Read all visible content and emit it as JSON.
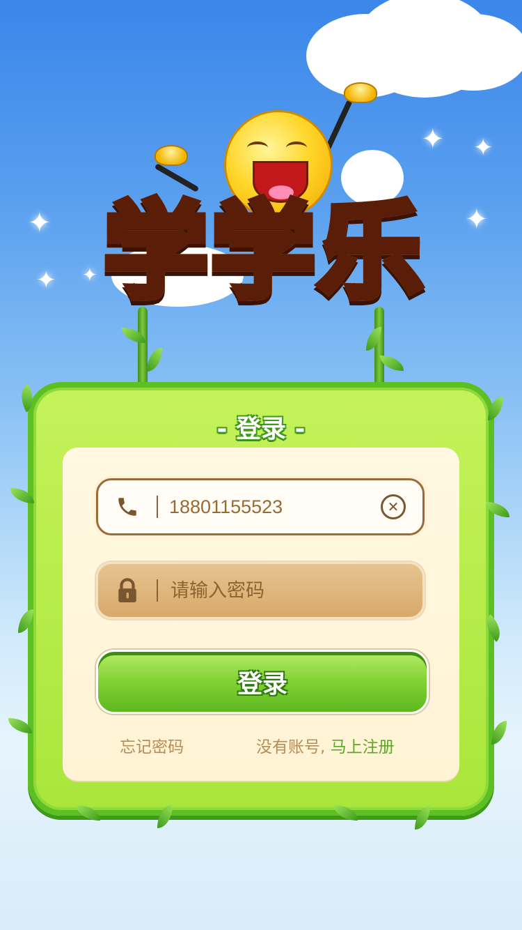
{
  "app": {
    "logo_text": "学学乐"
  },
  "login_card": {
    "title": "- 登录 -",
    "phone": {
      "value": "18801155523",
      "icon": "phone-icon",
      "clear_icon": "clear-icon"
    },
    "password": {
      "placeholder": "请输入密码",
      "icon": "lock-icon"
    },
    "login_button": "登录",
    "forgot_password": "忘记密码",
    "no_account": "没有账号,",
    "register_now": "马上注册"
  },
  "colors": {
    "accent_green": "#5cbf22",
    "text_brown": "#9a6a35",
    "link_green": "#5aa924"
  }
}
